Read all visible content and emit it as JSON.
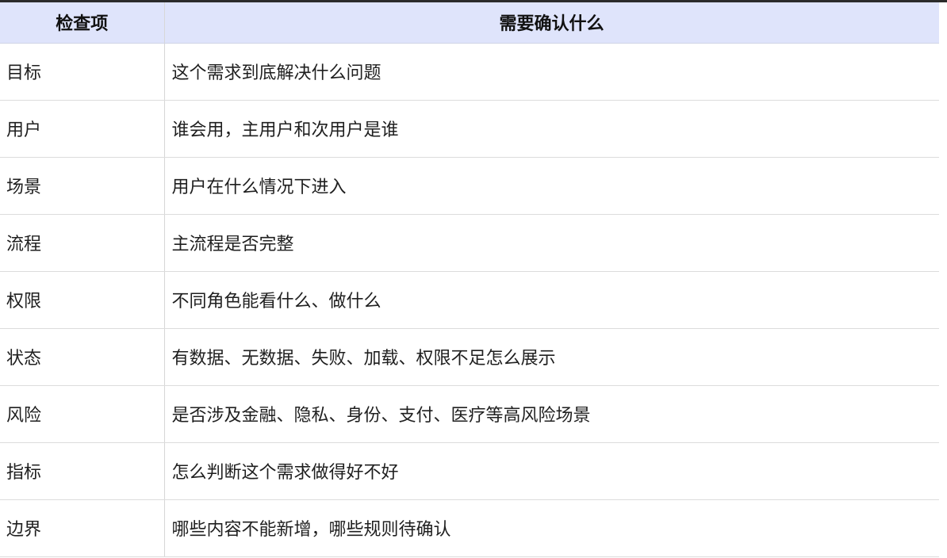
{
  "table": {
    "headers": {
      "item": "检查项",
      "confirm": "需要确认什么"
    },
    "rows": [
      {
        "item": "目标",
        "confirm": "这个需求到底解决什么问题"
      },
      {
        "item": "用户",
        "confirm": "谁会用，主用户和次用户是谁"
      },
      {
        "item": "场景",
        "confirm": "用户在什么情况下进入"
      },
      {
        "item": "流程",
        "confirm": "主流程是否完整"
      },
      {
        "item": "权限",
        "confirm": "不同角色能看什么、做什么"
      },
      {
        "item": "状态",
        "confirm": "有数据、无数据、失败、加载、权限不足怎么展示"
      },
      {
        "item": "风险",
        "confirm": "是否涉及金融、隐私、身份、支付、医疗等高风险场景"
      },
      {
        "item": "指标",
        "confirm": "怎么判断这个需求做得好不好"
      },
      {
        "item": "边界",
        "confirm": "哪些内容不能新增，哪些规则待确认"
      }
    ]
  },
  "colors": {
    "header_bg": "#dfe4fb",
    "border": "#d7d7d7",
    "top_line": "#2b2b2b"
  }
}
